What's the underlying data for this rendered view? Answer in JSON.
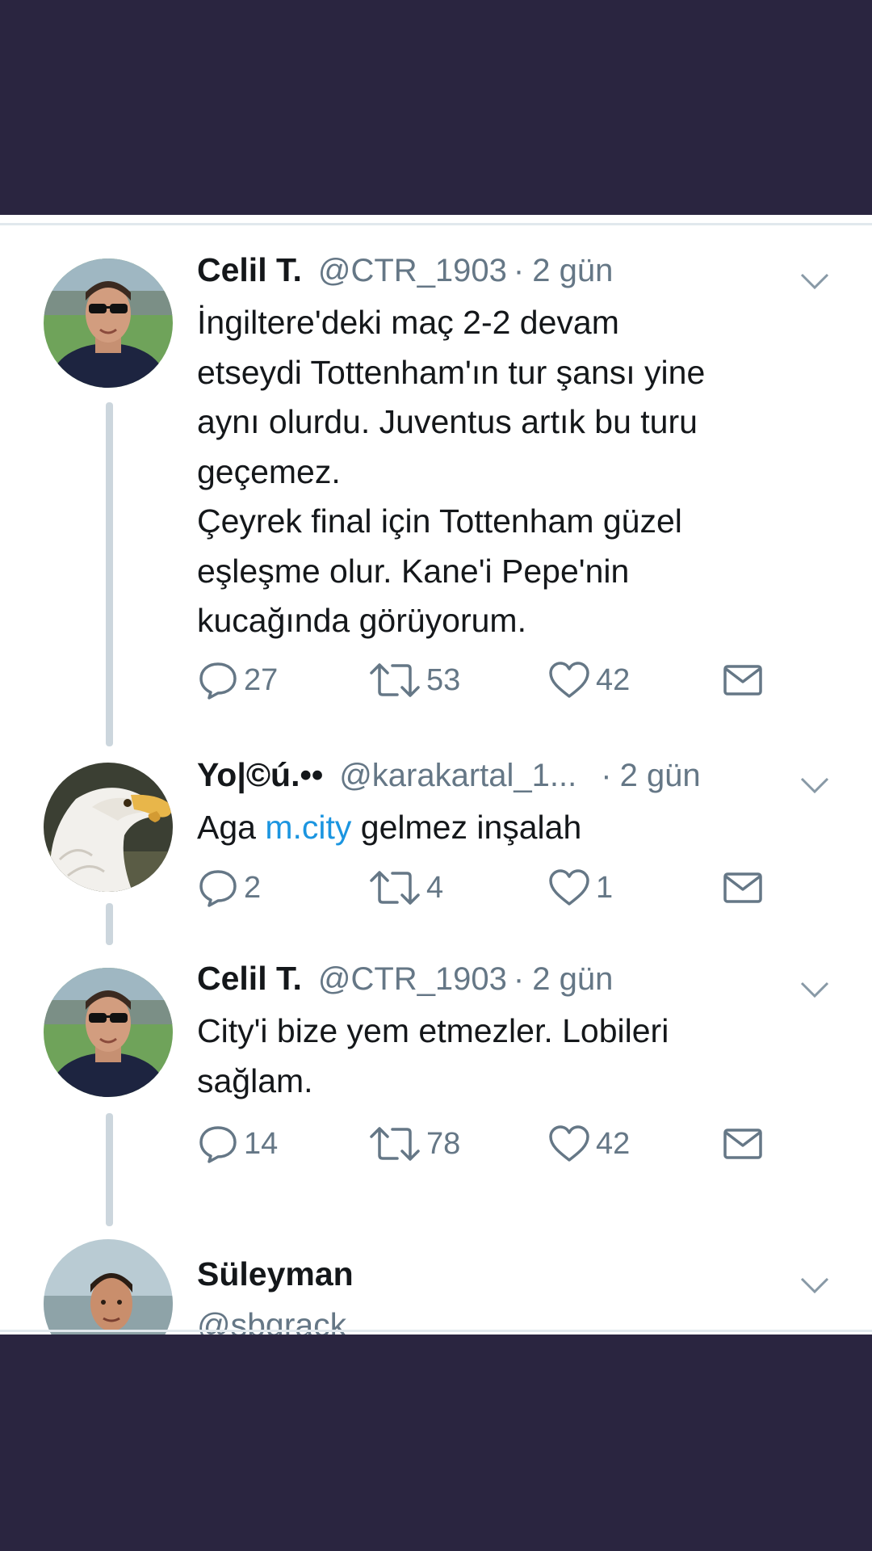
{
  "tweets": [
    {
      "name": "Celil T.",
      "handle": "@CTR_1903",
      "separator": "·",
      "time": "2 gün",
      "text": "İngiltere'deki maç 2-2 devam\netseydi Tottenham'ın tur şansı yine\naynı olurdu. Juventus artık bu turu\ngeçemez.\nÇeyrek final için Tottenham güzel\neşleşme olur. Kane'i Pepe'nin\nkucağında görüyorum.",
      "replies": "27",
      "retweets": "53",
      "likes": "42"
    },
    {
      "name": "Yo|©ú.••",
      "handle": "@karakartal_1...",
      "separator": "·",
      "time": "2 gün",
      "text_before": "Aga ",
      "link": "m.city",
      "text_after": " gelmez inşalah",
      "replies": "2",
      "retweets": "4",
      "likes": "1"
    },
    {
      "name": "Celil T.",
      "handle": "@CTR_1903",
      "separator": "·",
      "time": "2 gün",
      "text": "City'i bize yem etmezler. Lobileri\nsağlam.",
      "replies": "14",
      "retweets": "78",
      "likes": "42"
    },
    {
      "name": "Süleyman",
      "handle": "@sbgrack"
    }
  ],
  "colors": {
    "background": "#2a2540",
    "text": "#14171a",
    "secondary": "#657786",
    "link": "#1b95e0",
    "thread_line": "#ccd6dd"
  },
  "icons": [
    "reply-icon",
    "retweet-icon",
    "like-icon",
    "direct-message-icon",
    "chevron-down-icon"
  ]
}
